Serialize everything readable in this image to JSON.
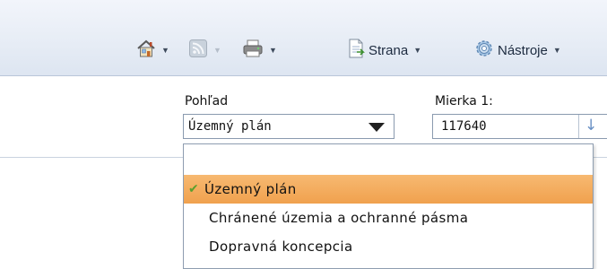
{
  "browser_toolbar": {
    "home_icon": "home-icon",
    "feeds_icon": "rss-feed-icon",
    "print_icon": "print-icon",
    "page_icon": "page-icon",
    "tools_icon": "gear-icon",
    "page_label": "Strana",
    "tools_label": "Nástroje"
  },
  "map_toolbar": {
    "view": {
      "label": "Pohľad",
      "selected": "Územný plán"
    },
    "scale": {
      "label": "Mierka 1:",
      "value": "117640"
    }
  },
  "view_dropdown": {
    "items": [
      {
        "label": "",
        "selected": false
      },
      {
        "label": "Územný plán",
        "selected": true
      },
      {
        "label": "Chránené územia a ochranné pásma",
        "selected": false
      },
      {
        "label": "Dopravná koncepcia",
        "selected": false
      }
    ]
  }
}
